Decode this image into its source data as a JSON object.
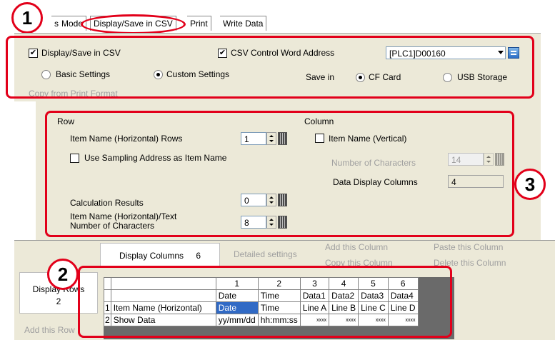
{
  "tabs": [
    {
      "label": "s"
    },
    {
      "label": "Mode"
    },
    {
      "label": "Display/Save in CSV"
    },
    {
      "label": "Print"
    },
    {
      "label": "Write Data"
    }
  ],
  "callouts": {
    "one": "1",
    "two": "2",
    "three": "3"
  },
  "csv_panel": {
    "display_save_label": "Display/Save in CSV",
    "display_save_checked": "✔",
    "control_word_label": "CSV Control Word Address",
    "control_word_checked": "✔",
    "address_value": "[PLC1]D00160",
    "basic_settings_label": "Basic Settings",
    "custom_settings_label": "Custom Settings",
    "save_in_label": "Save in",
    "cf_card_label": "CF Card",
    "usb_storage_label": "USB Storage",
    "copy_from_print_label": "Copy from Print Format"
  },
  "row_col_panel": {
    "row_heading": "Row",
    "column_heading": "Column",
    "item_name_rows_label": "Item Name (Horizontal) Rows",
    "item_name_rows_value": "1",
    "use_sampling_label": "Use Sampling Address as Item Name",
    "item_name_vertical_label": "Item Name (Vertical)",
    "number_of_chars_label": "Number of Characters",
    "number_of_chars_value": "14",
    "data_display_columns_label": "Data Display Columns",
    "data_display_columns_value": "4",
    "calc_results_label": "Calculation Results",
    "calc_results_value": "0",
    "item_text_chars_label_1": "Item Name (Horizontal)/Text",
    "item_text_chars_label_2": "Number of Characters",
    "item_text_chars_value": "8"
  },
  "grid_panel": {
    "display_columns_label": "Display Columns",
    "display_columns_value": "6",
    "detailed_settings_label": "Detailed settings",
    "add_column_label": "Add this Column",
    "copy_column_label": "Copy this Column",
    "paste_column_label": "Paste this Column",
    "delete_column_label": "Delete this Column",
    "display_rows_label": "Display Rows",
    "display_rows_value": "2",
    "add_row_label": "Add this Row"
  },
  "table": {
    "col_numbers": [
      "1",
      "2",
      "3",
      "4",
      "5",
      "6"
    ],
    "col_names": [
      "Date",
      "Time",
      "Data1",
      "Data2",
      "Data3",
      "Data4"
    ],
    "rows": [
      {
        "num": "1",
        "name": "Item Name (Horizontal)",
        "cells": [
          "Date",
          "Time",
          "Line A",
          "Line B",
          "Line C",
          "Line D"
        ]
      },
      {
        "num": "2",
        "name": "Show Data",
        "cells": [
          "yy/mm/dd",
          "hh:mm:ss",
          "xxxx",
          "xxxx",
          "xxxx",
          "xxxx"
        ]
      }
    ]
  },
  "colors": {
    "highlight": "#e2001a",
    "selection": "#316ac5",
    "panel": "#ece9d8"
  }
}
